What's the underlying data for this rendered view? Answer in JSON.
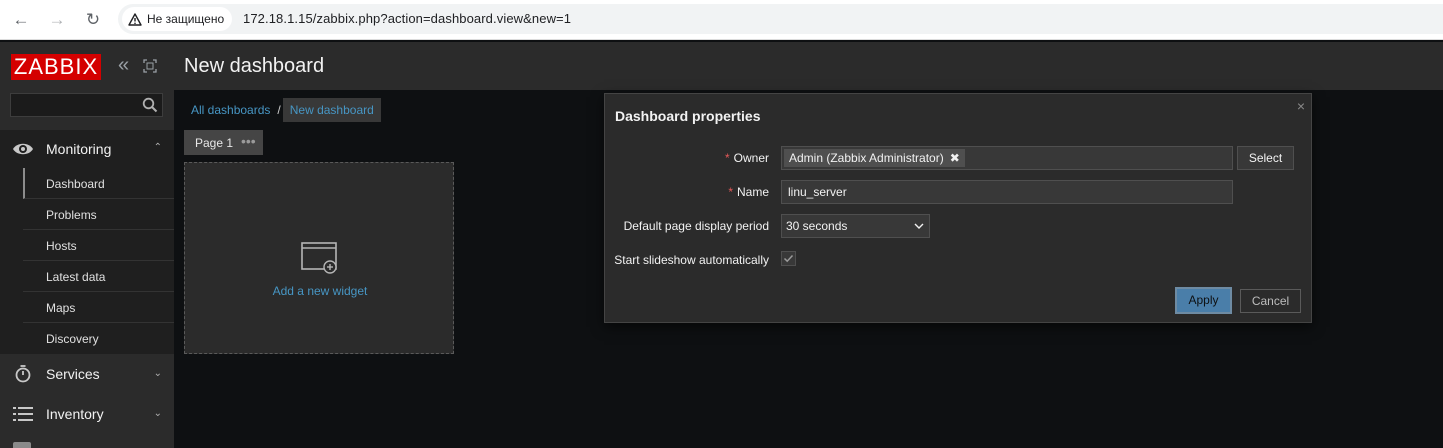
{
  "browser": {
    "security_label": "Не защищено",
    "url": "172.18.1.15/zabbix.php?action=dashboard.view&new=1"
  },
  "sidebar": {
    "logo": "ZABBIX",
    "search_value": "",
    "monitoring": {
      "label": "Monitoring",
      "items": [
        "Dashboard",
        "Problems",
        "Hosts",
        "Latest data",
        "Maps",
        "Discovery"
      ]
    },
    "services_label": "Services",
    "inventory_label": "Inventory"
  },
  "header": {
    "title": "New dashboard"
  },
  "breadcrumb": {
    "all": "All dashboards",
    "separator": "/",
    "current": "New dashboard"
  },
  "page_tab": {
    "label": "Page 1",
    "menu": "•••"
  },
  "widget": {
    "add_label": "Add a new widget"
  },
  "dialog": {
    "title": "Dashboard properties",
    "close": "×",
    "required_mark": "*",
    "owner_label": "Owner",
    "owner_value": "Admin (Zabbix Administrator)",
    "owner_remove": "✖",
    "select_label": "Select",
    "name_label": "Name",
    "name_value": "linu_server",
    "period_label": "Default page display period",
    "period_value": "30 seconds",
    "slideshow_label": "Start slideshow automatically",
    "slideshow_checked": true,
    "apply_label": "Apply",
    "cancel_label": "Cancel"
  },
  "colors": {
    "accent": "#4796c4",
    "logo_bg": "#d40000",
    "required": "#e45959"
  }
}
